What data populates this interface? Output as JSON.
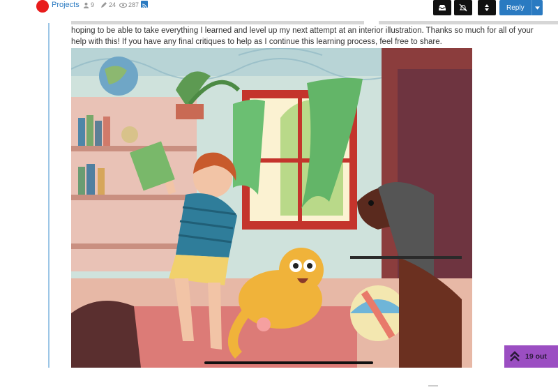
{
  "topbar": {
    "category": "Projects",
    "posts_count": "9",
    "edits_count": "24",
    "views_count": "287",
    "reply_label": "Reply"
  },
  "post": {
    "text": "hoping to be able to take everything I learned and level up my next attempt at an interior illustration. Thanks so much for all of your help with this! If you have any final critiques to help as I continue this learning process, feel free to share."
  },
  "unread": {
    "label": "19 out"
  },
  "colors": {
    "accent": "#2a7ac1",
    "category": "#e81c1c",
    "unread_bg": "#9b4ec2"
  },
  "icons": [
    "category-icon",
    "posts-icon",
    "edit-icon",
    "views-icon",
    "rss-icon",
    "inbox-icon",
    "mute-icon",
    "sort-icon",
    "chevron-down-icon",
    "double-chevron-up-icon"
  ]
}
